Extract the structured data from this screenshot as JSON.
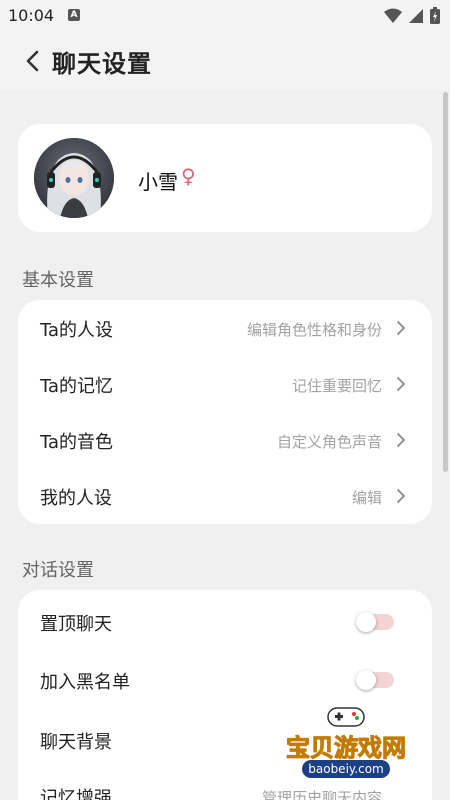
{
  "status_bar": {
    "time": "10:04",
    "notification_letter": "A"
  },
  "header": {
    "title": "聊天设置"
  },
  "profile": {
    "name": "小雪",
    "gender_symbol": "♀"
  },
  "sections": {
    "basic_title": "基本设置",
    "dialog_title": "对话设置"
  },
  "basic_settings": [
    {
      "label": "Ta的人设",
      "value": "编辑角色性格和身份"
    },
    {
      "label": "Ta的记忆",
      "value": "记住重要回忆"
    },
    {
      "label": "Ta的音色",
      "value": "自定义角色声音"
    },
    {
      "label": "我的人设",
      "value": "编辑"
    }
  ],
  "dialog_settings": [
    {
      "label": "置顶聊天",
      "toggle_on": false
    },
    {
      "label": "加入黑名单",
      "toggle_on": false
    },
    {
      "label": "聊天背景",
      "value": ""
    },
    {
      "label": "记忆增强",
      "value": "管理历史聊天内容"
    }
  ],
  "watermark": {
    "text": "宝贝游戏网",
    "url": "baobeiy.com"
  },
  "colors": {
    "accent_pink": "#e0637c",
    "toggle_track": "#f3d3d3",
    "background": "#f1f0f1"
  }
}
